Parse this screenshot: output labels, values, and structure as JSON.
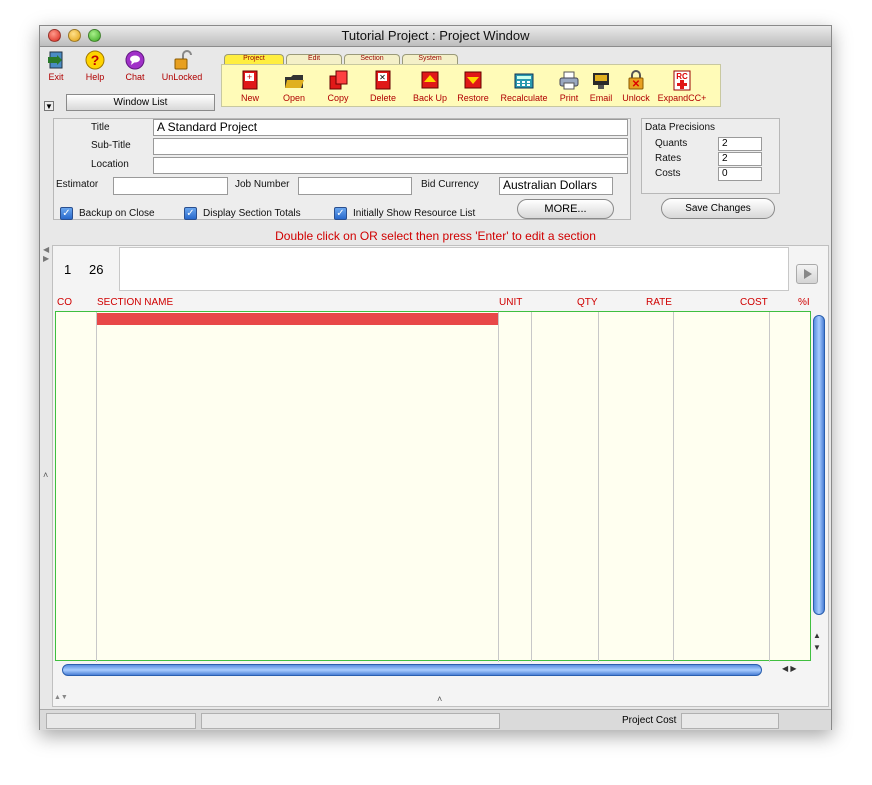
{
  "window": {
    "title": "Tutorial Project : Project Window"
  },
  "quick_tools": [
    {
      "label": "Exit",
      "icon": "exit-icon"
    },
    {
      "label": "Help",
      "icon": "help-icon"
    },
    {
      "label": "Chat",
      "icon": "chat-icon"
    },
    {
      "label": "UnLocked",
      "icon": "unlocked-padlock-icon"
    }
  ],
  "window_list_label": "Window List",
  "tabs": [
    "Project",
    "Edit",
    "Section",
    "System"
  ],
  "toolbar": [
    {
      "label": "New",
      "icon": "new-document-icon"
    },
    {
      "label": "Open",
      "icon": "open-folder-icon"
    },
    {
      "label": "Copy",
      "icon": "copy-icon"
    },
    {
      "label": "Delete",
      "icon": "delete-icon"
    },
    {
      "label": "Back Up",
      "icon": "backup-icon"
    },
    {
      "label": "Restore",
      "icon": "restore-icon"
    },
    {
      "label": "Recalculate",
      "icon": "calculator-icon"
    },
    {
      "label": "Print",
      "icon": "printer-icon"
    },
    {
      "label": "Email",
      "icon": "email-icon"
    },
    {
      "label": "Unlock",
      "icon": "unlock-icon"
    },
    {
      "label": "ExpandCC+",
      "icon": "expand-cc-icon"
    }
  ],
  "form": {
    "title_label": "Title",
    "title_value": "A Standard Project",
    "subtitle_label": "Sub-Title",
    "subtitle_value": "",
    "location_label": "Location",
    "location_value": "",
    "estimator_label": "Estimator",
    "estimator_value": "",
    "job_number_label": "Job Number",
    "job_number_value": "",
    "bid_currency_label": "Bid Currency",
    "bid_currency_value": "Australian Dollars",
    "more_button": "MORE...",
    "save_button": "Save Changes",
    "backup_on_close": "Backup on Close",
    "display_section_totals": "Display Section Totals",
    "initially_show_resource_list": "Initially Show Resource List"
  },
  "precisions": {
    "title": "Data Precisions",
    "quants_label": "Quants",
    "quants_value": "2",
    "rates_label": "Rates",
    "rates_value": "2",
    "costs_label": "Costs",
    "costs_value": "0"
  },
  "instruction": "Double click on OR select then press 'Enter' to edit a section",
  "counter": {
    "current": "1",
    "total": "26"
  },
  "columns": [
    "CO",
    "SECTION NAME",
    "UNIT",
    "QTY",
    "RATE",
    "COST",
    "%I"
  ],
  "status": {
    "project_cost_label": "Project Cost",
    "project_cost_value": ""
  },
  "colors": {
    "accent_red": "#d00000",
    "toolbar_yellow": "#fffbb8",
    "grid_green": "#3fbf3f",
    "selection_red": "#e84848"
  }
}
